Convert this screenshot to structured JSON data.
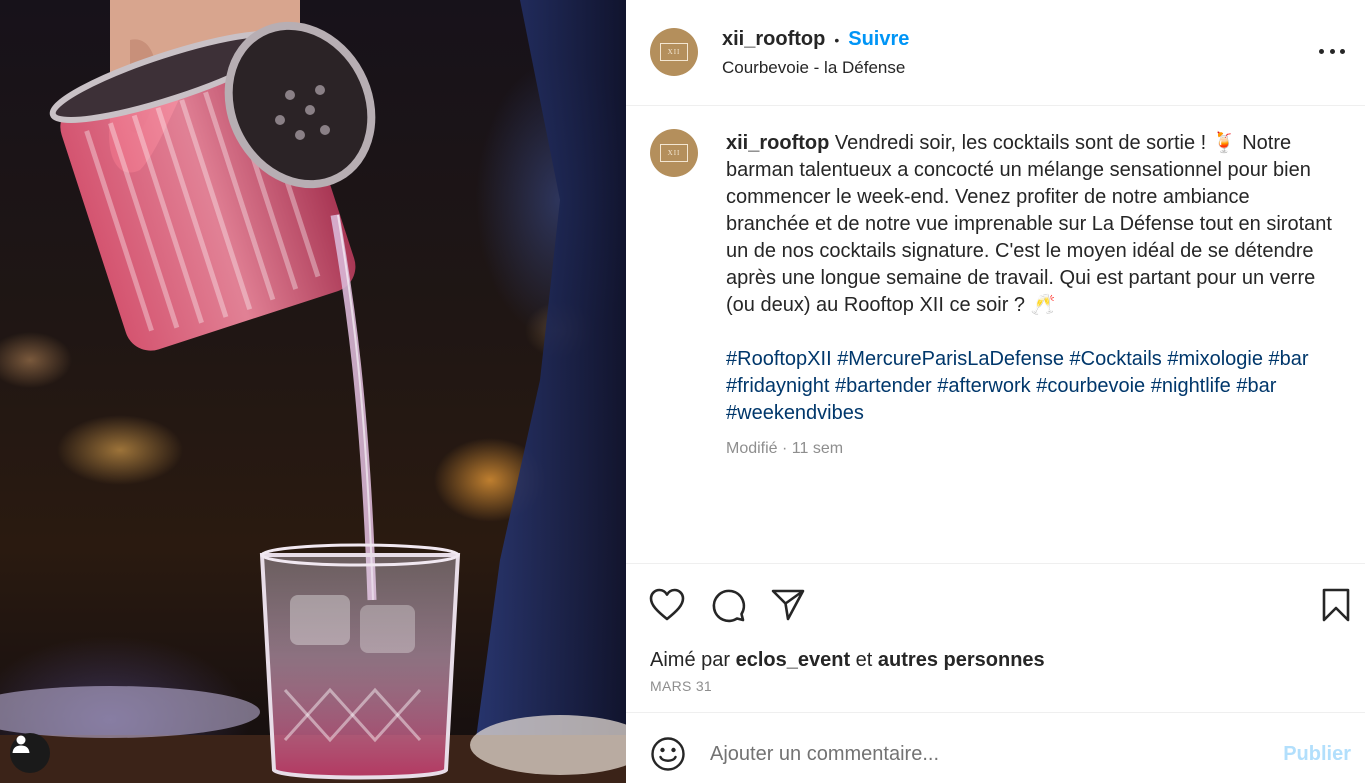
{
  "post": {
    "username": "xii_rooftop",
    "avatar_text": "XII",
    "separator": "•",
    "follow_label": "Suivre",
    "location": "Courbevoie - la Défense",
    "more_icon": "more-horizontal-icon",
    "caption_text": "Vendredi soir, les cocktails sont de sortie ! 🍹 Notre barman talentueux a concocté un mélange sensationnel pour bien commencer le week-end. Venez profiter de notre ambiance branchée et de notre vue imprenable sur La Défense tout en sirotant un de nos cocktails signature. C'est le moyen idéal de se détendre après une longue semaine de travail. Qui est partant pour un verre (ou deux) au Rooftop XII ce soir ? 🥂",
    "hashtags": [
      "#RooftopXII",
      "#MercureParisLaDefense",
      "#Cocktails",
      "#mixologie",
      "#bar",
      "#fridaynight",
      "#bartender",
      "#afterwork",
      "#courbevoie",
      "#nightlife",
      "#bar",
      "#weekendvibes"
    ],
    "edited_label": "Modifié · 11 sem"
  },
  "actions": {
    "like_icon": "heart-icon",
    "comment_icon": "comment-icon",
    "share_icon": "send-icon",
    "save_icon": "bookmark-icon",
    "liked_prefix": "Aimé par",
    "liked_user": "eclos_event",
    "liked_and": "et",
    "liked_others": "autres personnes",
    "date": "MARS 31"
  },
  "comment": {
    "emoji_icon": "emoji-icon",
    "placeholder": "Ajouter un commentaire...",
    "publish_label": "Publier"
  },
  "photo": {
    "alt": "Barman versant un cocktail rose dans un verre",
    "account_icon": "user-icon"
  },
  "colors": {
    "accent_blue": "#0095f6",
    "hashtag_blue": "#00376b",
    "avatar_gold": "#b48f5c",
    "muted_gray": "#8e8e8e"
  }
}
